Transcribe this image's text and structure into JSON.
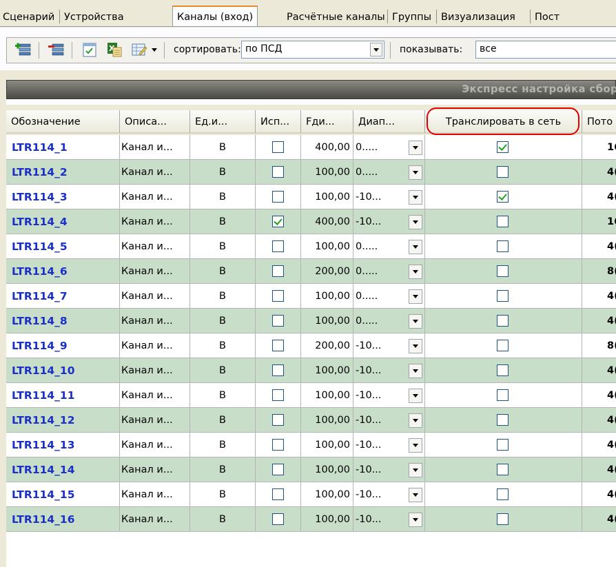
{
  "tabs": [
    {
      "label": "Сценарий",
      "active": false
    },
    {
      "label": "Устройства",
      "active": false
    },
    {
      "label": "Каналы (вход)",
      "active": true
    },
    {
      "label": "Расчётные каналы",
      "active": false
    },
    {
      "label": "Группы",
      "active": false
    },
    {
      "label": "Визуализация",
      "active": false
    },
    {
      "label": "Пост",
      "active": false
    }
  ],
  "toolbar": {
    "sort_label": "сортировать:",
    "sort_value": "по ПСД",
    "show_label": "показывать:",
    "show_value": "все"
  },
  "banner": {
    "text": "Экспресс настройка сбор"
  },
  "table": {
    "columns": [
      "Обозначение",
      "Описа...",
      "Ед.и...",
      "Исп...",
      "Fди...",
      "Диап...",
      "Транслировать в сеть",
      "Пото"
    ],
    "rows": [
      {
        "name": "LTR114_1",
        "desc": "Канал и...",
        "unit": "В",
        "use": false,
        "freq": "400,00",
        "range": "0.....",
        "broadcast": true,
        "pot": "16"
      },
      {
        "name": "LTR114_2",
        "desc": "Канал и...",
        "unit": "В",
        "use": false,
        "freq": "100,00",
        "range": "0.....",
        "broadcast": false,
        "pot": "4("
      },
      {
        "name": "LTR114_3",
        "desc": "Канал и...",
        "unit": "В",
        "use": false,
        "freq": "100,00",
        "range": "-10...",
        "broadcast": true,
        "pot": "4("
      },
      {
        "name": "LTR114_4",
        "desc": "Канал и...",
        "unit": "В",
        "use": true,
        "freq": "400,00",
        "range": "-10...",
        "broadcast": false,
        "pot": "16"
      },
      {
        "name": "LTR114_5",
        "desc": "Канал и...",
        "unit": "В",
        "use": false,
        "freq": "100,00",
        "range": "0.....",
        "broadcast": false,
        "pot": "4("
      },
      {
        "name": "LTR114_6",
        "desc": "Канал и...",
        "unit": "В",
        "use": false,
        "freq": "200,00",
        "range": "0.....",
        "broadcast": false,
        "pot": "8("
      },
      {
        "name": "LTR114_7",
        "desc": "Канал и...",
        "unit": "В",
        "use": false,
        "freq": "100,00",
        "range": "0.....",
        "broadcast": false,
        "pot": "4("
      },
      {
        "name": "LTR114_8",
        "desc": "Канал и...",
        "unit": "В",
        "use": false,
        "freq": "100,00",
        "range": "0.....",
        "broadcast": false,
        "pot": "4("
      },
      {
        "name": "LTR114_9",
        "desc": "Канал и...",
        "unit": "В",
        "use": false,
        "freq": "200,00",
        "range": "-10...",
        "broadcast": false,
        "pot": "8("
      },
      {
        "name": "LTR114_10",
        "desc": "Канал и...",
        "unit": "В",
        "use": false,
        "freq": "100,00",
        "range": "-10...",
        "broadcast": false,
        "pot": "4("
      },
      {
        "name": "LTR114_11",
        "desc": "Канал и...",
        "unit": "В",
        "use": false,
        "freq": "100,00",
        "range": "-10...",
        "broadcast": false,
        "pot": "4("
      },
      {
        "name": "LTR114_12",
        "desc": "Канал и...",
        "unit": "В",
        "use": false,
        "freq": "100,00",
        "range": "-10...",
        "broadcast": false,
        "pot": "4("
      },
      {
        "name": "LTR114_13",
        "desc": "Канал и...",
        "unit": "В",
        "use": false,
        "freq": "100,00",
        "range": "-10...",
        "broadcast": false,
        "pot": "4("
      },
      {
        "name": "LTR114_14",
        "desc": "Канал и...",
        "unit": "В",
        "use": false,
        "freq": "100,00",
        "range": "-10...",
        "broadcast": false,
        "pot": "4("
      },
      {
        "name": "LTR114_15",
        "desc": "Канал и...",
        "unit": "В",
        "use": false,
        "freq": "100,00",
        "range": "-10...",
        "broadcast": false,
        "pot": "4("
      },
      {
        "name": "LTR114_16",
        "desc": "Канал и...",
        "unit": "В",
        "use": false,
        "freq": "100,00",
        "range": "-10...",
        "broadcast": false,
        "pot": "4("
      }
    ]
  },
  "colors": {
    "row_alt": "#c8dec9",
    "name_text": "#1a30c8",
    "checkmark": "#21a121",
    "highlight": "#e00000",
    "active_tab_top": "#e68b2c"
  }
}
